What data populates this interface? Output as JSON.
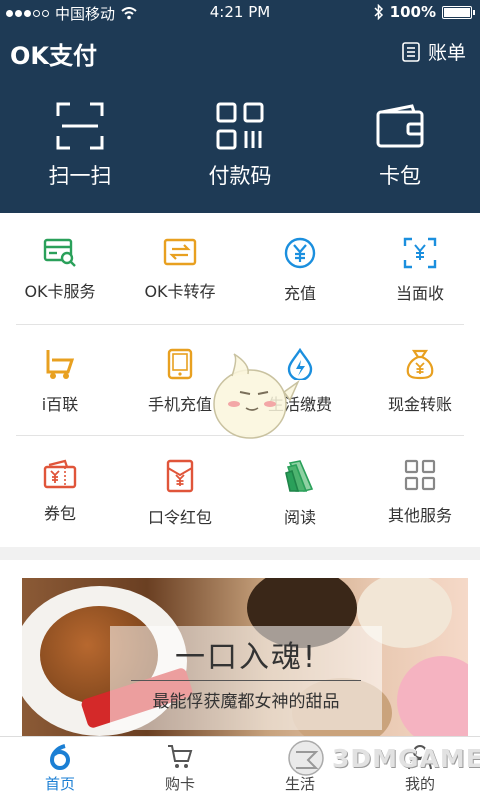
{
  "status_bar": {
    "carrier": "中国移动",
    "time": "4:21 PM",
    "battery": "100%",
    "battery_level": 1.0
  },
  "app_bar": {
    "title": "OK支付",
    "bill_label": "账单",
    "bill_icon": "list-document-icon"
  },
  "hero": [
    {
      "label": "扫一扫",
      "icon": "scan-icon"
    },
    {
      "label": "付款码",
      "icon": "qr-code-icon"
    },
    {
      "label": "卡包",
      "icon": "wallet-icon"
    }
  ],
  "grid": [
    {
      "label": "OK卡服务",
      "icon": "card-search-icon",
      "color": "#2aa05a"
    },
    {
      "label": "OK卡转存",
      "icon": "card-transfer-icon",
      "color": "#e8a020"
    },
    {
      "label": "充值",
      "icon": "yuan-circle-icon",
      "color": "#1b8fde"
    },
    {
      "label": "当面收",
      "icon": "scan-yuan-icon",
      "color": "#1b8fde"
    },
    {
      "label": "i百联",
      "icon": "shopping-cart-b-icon",
      "color": "#e8a020"
    },
    {
      "label": "手机充值",
      "icon": "phone-icon",
      "color": "#e8a020"
    },
    {
      "label": "生活缴费",
      "icon": "water-drop-bolt-icon",
      "color": "#1b8fde"
    },
    {
      "label": "现金转账",
      "icon": "money-bag-icon",
      "color": "#e8a020"
    },
    {
      "label": "券包",
      "icon": "coupon-icon",
      "color": "#e0553a"
    },
    {
      "label": "口令红包",
      "icon": "red-envelope-icon",
      "color": "#e0553a"
    },
    {
      "label": "阅读",
      "icon": "book-icon",
      "color": "#2aa05a"
    },
    {
      "label": "其他服务",
      "icon": "grid-icon",
      "color": "#888888"
    }
  ],
  "banner": {
    "title": "一口入魂!",
    "subtitle": "最能俘获魔都女神的甜品"
  },
  "tabs": [
    {
      "label": "首页",
      "icon": "home-six-icon",
      "active": true
    },
    {
      "label": "购卡",
      "icon": "cart-icon",
      "active": false
    },
    {
      "label": "生活",
      "icon": "life-icon",
      "active": false
    },
    {
      "label": "我的",
      "icon": "person-icon",
      "active": false
    }
  ],
  "colors": {
    "header": "#1e3a55",
    "active_tab": "#1b7fd4"
  },
  "watermark": "3DMGAME"
}
